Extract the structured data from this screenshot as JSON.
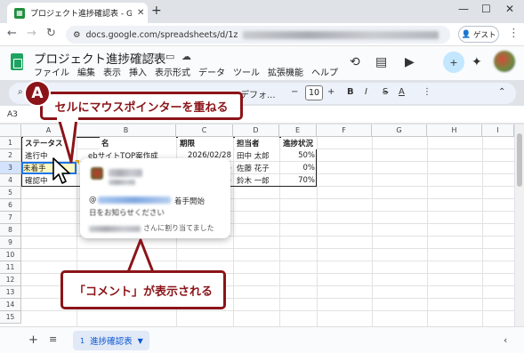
{
  "browser": {
    "tab_title": "プロジェクト進捗確認表 - Google",
    "url_visible": "docs.google.com/spreadsheets/d/1z",
    "guest_label": "ゲスト"
  },
  "app": {
    "doc_title": "プロジェクト進捗確認表",
    "menus": [
      "ファイル",
      "編集",
      "表示",
      "挿入",
      "表示形式",
      "データ",
      "ツール",
      "拡張機能",
      "ヘルプ"
    ],
    "toolbar_font": "デフォ...",
    "font_size": "10",
    "cell_ref": "A3"
  },
  "sheet": {
    "columns": [
      "A",
      "B",
      "C",
      "D",
      "E",
      "F",
      "G",
      "H",
      "I"
    ],
    "rows": [
      "1",
      "2",
      "3",
      "4",
      "5",
      "6",
      "7",
      "8",
      "9",
      "10",
      "11",
      "12",
      "13",
      "14",
      "15"
    ],
    "header": [
      "ステータス",
      "タスク名",
      "期限",
      "担当者",
      "進捗状況"
    ],
    "data": [
      [
        "進行中",
        "Webサイト TOP案作成",
        "2026/02/28",
        "田中 太郎",
        "50%"
      ],
      [
        "未着手",
        "",
        "",
        "佐藤 花子",
        "0%"
      ],
      [
        "確認中",
        "",
        "",
        "鈴木 一郎",
        "70%"
      ]
    ],
    "header_b_visible": "名",
    "row2_b_visible": "ebサイトTOP案作成",
    "row3_c_visible": "5",
    "row4_c_visible": "5",
    "tab_num": "1",
    "tab_name": "進捗確認表"
  },
  "comment": {
    "text_suffix": "着手開始",
    "line2": "日をお知らせください",
    "assigned_suffix": "さんに割り当てました"
  },
  "annotations": {
    "badge": "A",
    "callout_top": "セルにマウスポインターを重ねる",
    "callout_bottom": "「コメント」が表示される"
  },
  "colors": {
    "accent": "#8b1418",
    "sheets_green": "#1ea362",
    "selection": "#1a73e8"
  }
}
